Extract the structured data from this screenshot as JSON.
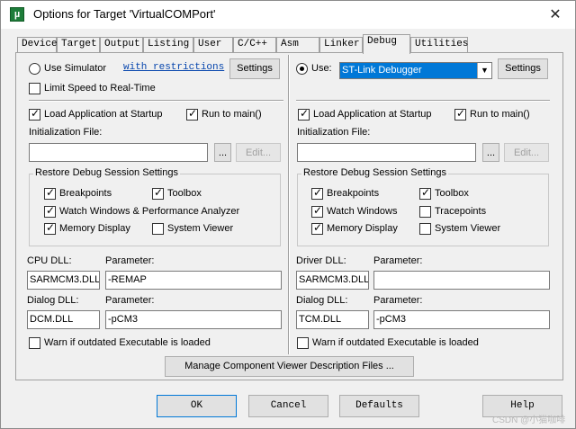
{
  "window": {
    "title": "Options for Target 'VirtualCOMPort'",
    "app_icon": "µ",
    "close_glyph": "✕"
  },
  "tabs": [
    "Device",
    "Target",
    "Output",
    "Listing",
    "User",
    "C/C++",
    "Asm",
    "Linker",
    "Debug",
    "Utilities"
  ],
  "active_tab": "Debug",
  "left": {
    "use_simulator": "Use Simulator",
    "simulator_selected": false,
    "with_restrictions": "with restrictions",
    "settings": "Settings",
    "limit_speed": "Limit Speed to Real-Time",
    "limit_speed_checked": false,
    "load_app": "Load Application at Startup",
    "load_app_checked": true,
    "run_main": "Run to main()",
    "run_main_checked": true,
    "init_file_label": "Initialization File:",
    "init_file_value": "",
    "browse": "...",
    "edit": "Edit...",
    "restore_title": "Restore Debug Session Settings",
    "breakpoints": "Breakpoints",
    "toolbox": "Toolbox",
    "watch": "Watch Windows & Performance Analyzer",
    "memory": "Memory Display",
    "system_viewer": "System Viewer",
    "dll_label": "CPU DLL:",
    "param_label": "Parameter:",
    "dll_value": "SARMCM3.DLL",
    "dll_param": "-REMAP",
    "dialog_label": "Dialog DLL:",
    "dialog_param_label": "Parameter:",
    "dialog_value": "DCM.DLL",
    "dialog_param": "-pCM3",
    "warn": "Warn if outdated Executable is loaded"
  },
  "right": {
    "use": "Use:",
    "use_selected": true,
    "debugger": "ST-Link Debugger",
    "settings": "Settings",
    "load_app": "Load Application at Startup",
    "run_main": "Run to main()",
    "init_file_label": "Initialization File:",
    "init_file_value": "",
    "browse": "...",
    "edit": "Edit...",
    "restore_title": "Restore Debug Session Settings",
    "breakpoints": "Breakpoints",
    "toolbox": "Toolbox",
    "watch": "Watch Windows",
    "tracepoints": "Tracepoints",
    "memory": "Memory Display",
    "system_viewer": "System Viewer",
    "dll_label": "Driver DLL:",
    "param_label": "Parameter:",
    "dll_value": "SARMCM3.DLL",
    "dll_param": "",
    "dialog_label": "Dialog DLL:",
    "dialog_param_label": "Parameter:",
    "dialog_value": "TCM.DLL",
    "dialog_param": "-pCM3",
    "warn": "Warn if outdated Executable is loaded"
  },
  "manage_viewer": "Manage Component Viewer Description Files ...",
  "footer": {
    "ok": "OK",
    "cancel": "Cancel",
    "defaults": "Defaults",
    "help": "Help"
  },
  "watermark": "CSDN @小猫咖啡",
  "colors": {
    "selection": "#0078d7",
    "link": "#0645ad"
  }
}
